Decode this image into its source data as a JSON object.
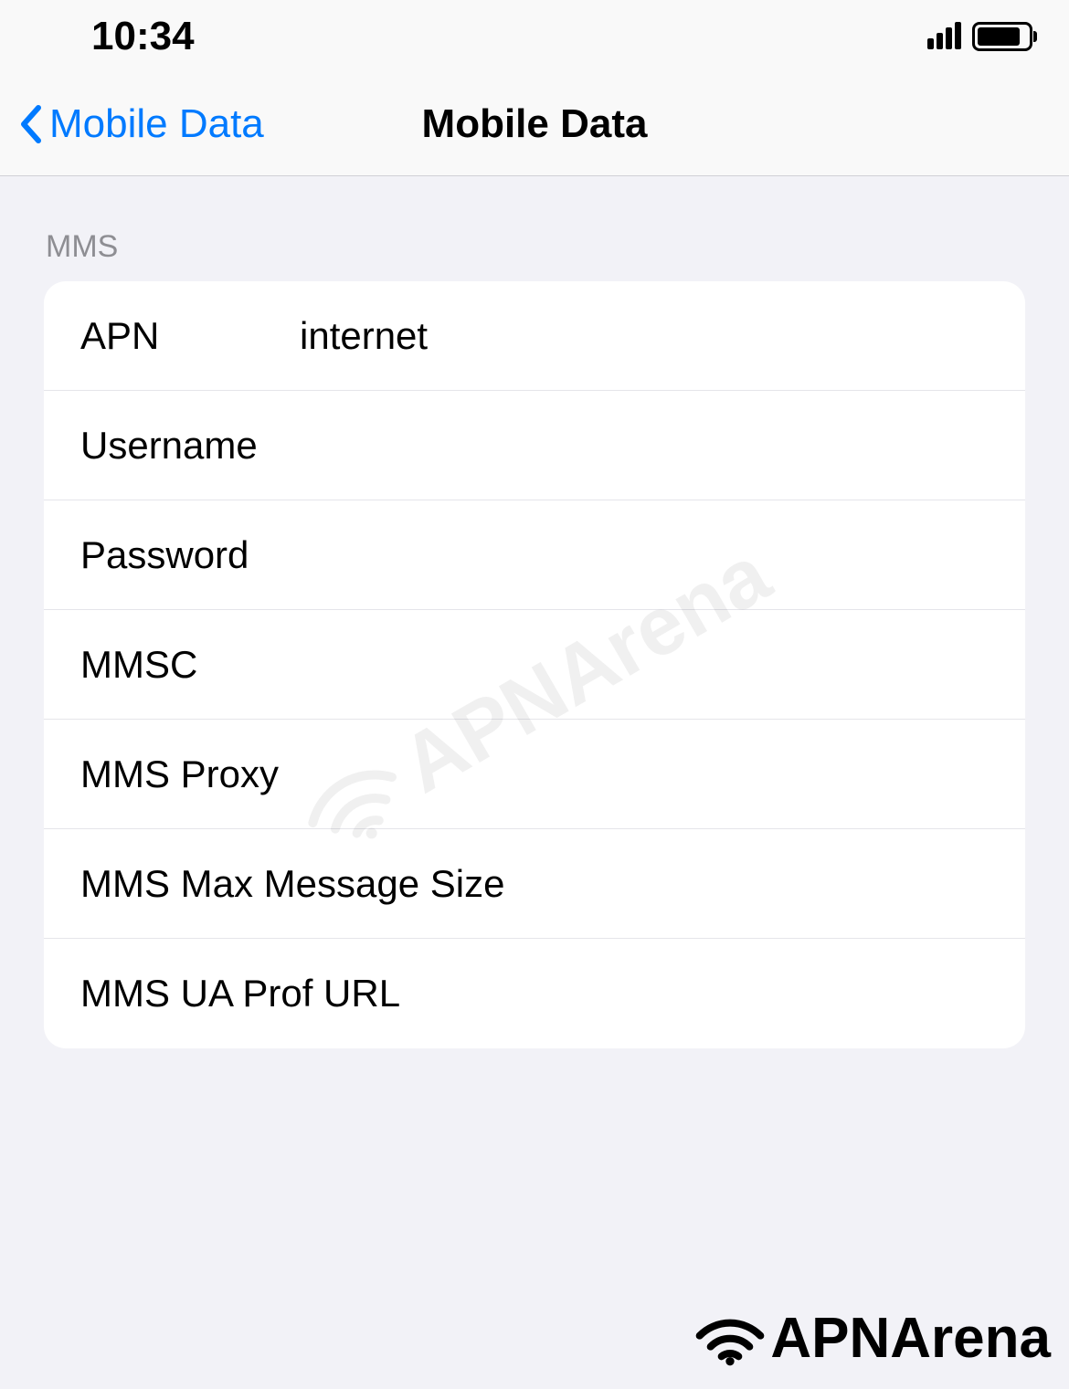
{
  "status_bar": {
    "time": "10:34"
  },
  "nav": {
    "back_label": "Mobile Data",
    "title": "Mobile Data"
  },
  "section": {
    "header": "MMS",
    "rows": [
      {
        "label": "APN",
        "value": "internet"
      },
      {
        "label": "Username",
        "value": ""
      },
      {
        "label": "Password",
        "value": ""
      },
      {
        "label": "MMSC",
        "value": ""
      },
      {
        "label": "MMS Proxy",
        "value": ""
      },
      {
        "label": "MMS Max Message Size",
        "value": ""
      },
      {
        "label": "MMS UA Prof URL",
        "value": ""
      }
    ]
  },
  "watermark": {
    "brand": "APNArena"
  }
}
